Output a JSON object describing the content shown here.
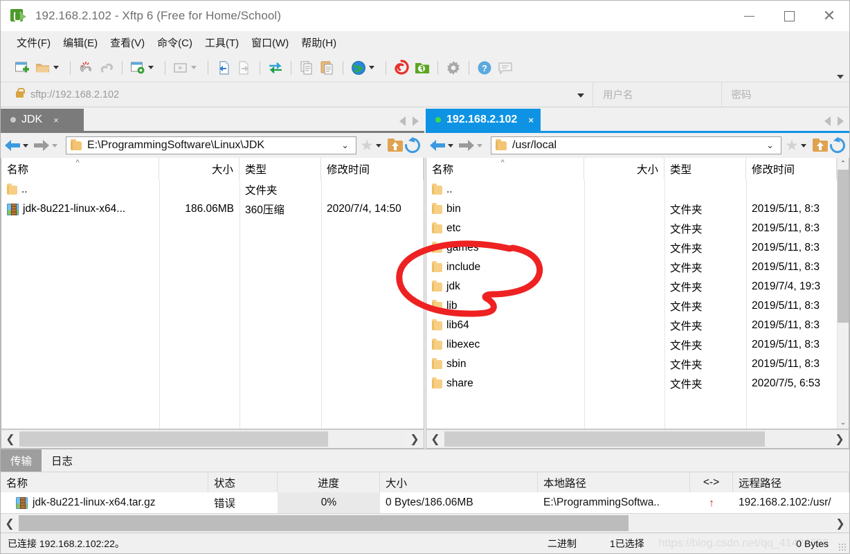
{
  "window": {
    "title": "192.168.2.102 - Xftp 6 (Free for Home/School)",
    "app_icon": "xftp-logo-icon",
    "minimize_label": "",
    "maximize_label": "",
    "close_label": "✕"
  },
  "menubar": {
    "items": [
      {
        "label": "文件(F)",
        "name": "menu-file"
      },
      {
        "label": "编辑(E)",
        "name": "menu-edit"
      },
      {
        "label": "查看(V)",
        "name": "menu-view"
      },
      {
        "label": "命令(C)",
        "name": "menu-command"
      },
      {
        "label": "工具(T)",
        "name": "menu-tools"
      },
      {
        "label": "窗口(W)",
        "name": "menu-window"
      },
      {
        "label": "帮助(H)",
        "name": "menu-help"
      }
    ]
  },
  "toolbar": {
    "icons": [
      "new-session-icon",
      "open-folder-icon",
      "disconnect-icon",
      "link-icon",
      "session-properties-icon",
      "run-icon",
      "transfer-in-icon",
      "transfer-out-icon",
      "sync-transfer-icon",
      "copy-icon",
      "paste-icon",
      "globe-icon",
      "xshell-icon",
      "xftp-green-icon",
      "settings-gear-icon",
      "help-icon",
      "chat-icon"
    ],
    "overflow": "toolbar-overflow-chevron"
  },
  "addressbar": {
    "protocol_icon": "lock-icon",
    "url": "sftp://192.168.2.102",
    "dropdown_icon": "chevron-down-icon",
    "username_placeholder": "用户名",
    "username_value": "",
    "password_placeholder": "密码",
    "password_value": ""
  },
  "left_pane": {
    "tab": {
      "label": "JDK",
      "status": "idle",
      "close": "×"
    },
    "nav": {
      "back_icon": "back-arrow-icon",
      "forward_icon": "forward-arrow-icon",
      "path": "E:\\ProgrammingSoftware\\Linux\\JDK",
      "path_dropdown": "⌄",
      "bookmark_icon": "star-icon",
      "up_icon": "up-folder-icon",
      "refresh_icon": "refresh-icon"
    },
    "columns": [
      "名称",
      "大小",
      "类型",
      "修改时间"
    ],
    "sort_indicator": "^",
    "rows": [
      {
        "icon": "folder-icon",
        "name": "..",
        "size": "",
        "type": "文件夹",
        "modified": ""
      },
      {
        "icon": "archive-icon",
        "name": "jdk-8u221-linux-x64...",
        "size": "186.06MB",
        "type": "360压缩",
        "modified": "2020/7/4, 14:50"
      }
    ],
    "hscroll": {
      "left": "❮",
      "right": "❯"
    }
  },
  "right_pane": {
    "tab": {
      "label": "192.168.2.102",
      "status": "connected",
      "close": "×"
    },
    "nav": {
      "back_icon": "back-arrow-icon",
      "forward_icon": "forward-arrow-icon",
      "path": "/usr/local",
      "path_dropdown": "⌄",
      "bookmark_icon": "star-icon",
      "up_icon": "up-folder-icon",
      "refresh_icon": "refresh-icon"
    },
    "columns": [
      "名称",
      "大小",
      "类型",
      "修改时间"
    ],
    "sort_indicator": "^",
    "rows": [
      {
        "icon": "folder-icon",
        "name": "..",
        "size": "",
        "type": "",
        "modified": ""
      },
      {
        "icon": "folder-icon",
        "name": "bin",
        "size": "",
        "type": "文件夹",
        "modified": "2019/5/11, 8:3"
      },
      {
        "icon": "folder-icon",
        "name": "etc",
        "size": "",
        "type": "文件夹",
        "modified": "2019/5/11, 8:3"
      },
      {
        "icon": "folder-icon",
        "name": "games",
        "size": "",
        "type": "文件夹",
        "modified": "2019/5/11, 8:3"
      },
      {
        "icon": "folder-icon",
        "name": "include",
        "size": "",
        "type": "文件夹",
        "modified": "2019/5/11, 8:3"
      },
      {
        "icon": "folder-icon",
        "name": "jdk",
        "size": "",
        "type": "文件夹",
        "modified": "2019/7/4, 19:3"
      },
      {
        "icon": "folder-icon",
        "name": "lib",
        "size": "",
        "type": "文件夹",
        "modified": "2019/5/11, 8:3"
      },
      {
        "icon": "folder-icon",
        "name": "lib64",
        "size": "",
        "type": "文件夹",
        "modified": "2019/5/11, 8:3"
      },
      {
        "icon": "folder-icon",
        "name": "libexec",
        "size": "",
        "type": "文件夹",
        "modified": "2019/5/11, 8:3"
      },
      {
        "icon": "folder-icon",
        "name": "sbin",
        "size": "",
        "type": "文件夹",
        "modified": "2019/5/11, 8:3"
      },
      {
        "icon": "folder-icon",
        "name": "share",
        "size": "",
        "type": "文件夹",
        "modified": "2020/7/5, 6:53"
      }
    ],
    "vscroll": {
      "up": "⌃",
      "down": "⌄"
    },
    "hscroll": {
      "left": "❮",
      "right": "❯"
    }
  },
  "annotation": {
    "color": "#ee2222",
    "shape": "hand-drawn-circle",
    "encircles": [
      "games",
      "include",
      "jdk"
    ]
  },
  "bottom_panel": {
    "tabs": [
      {
        "label": "传输",
        "active": true,
        "name": "tab-transfer"
      },
      {
        "label": "日志",
        "active": false,
        "name": "tab-log"
      }
    ],
    "columns": [
      "名称",
      "状态",
      "进度",
      "大小",
      "本地路径",
      "<->",
      "远程路径"
    ],
    "rows": [
      {
        "icon": "archive-icon",
        "name": "jdk-8u221-linux-x64.tar.gz",
        "status": "错误",
        "progress": "0%",
        "size": "0 Bytes/186.06MB",
        "local_path": "E:\\ProgrammingSoftwa..",
        "direction": "↑",
        "remote_path": "192.168.2.102:/usr/"
      }
    ],
    "hscroll": {
      "left": "❮",
      "right": "❯"
    }
  },
  "statusbar": {
    "connection": "已连接 192.168.2.102:22。",
    "mode": "二进制",
    "selection": "1已选择",
    "bytes": "0 Bytes"
  },
  "watermark": {
    "text": "https://blog.csdn.net/qq_41424688"
  },
  "colors": {
    "accent_blue": "#0e93e4",
    "tab_inactive": "#7b7b7b",
    "annotation_red": "#ee2222",
    "error_red": "#c11515",
    "window_bg": "#f0f0f0"
  }
}
